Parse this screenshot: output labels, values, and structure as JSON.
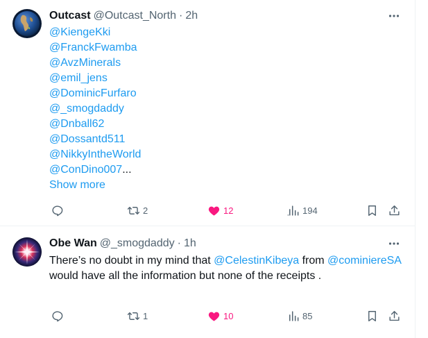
{
  "tweets": [
    {
      "author": {
        "name": "Outcast",
        "handle": "@Outcast_North",
        "avatar_icon": "globe-avatar-icon"
      },
      "time": "2h",
      "mentions": [
        "@KiengeKki",
        "@FranckFwamba",
        "@AvzMinerals",
        "@emil_jens",
        "@DominicFurfaro",
        "@_smogdaddy",
        "@Dnball62",
        "@Dossantd511",
        "@NikkyIntheWorld",
        "@ConDino007"
      ],
      "ellipsis": "...",
      "show_more": "Show more",
      "metrics": {
        "replies": "",
        "retweets": "2",
        "likes": "12",
        "views": "194"
      }
    },
    {
      "author": {
        "name": "Obe Wan",
        "handle": "@_smogdaddy",
        "avatar_icon": "starburst-avatar-icon"
      },
      "time": "1h",
      "text": {
        "p1": "There’s no doubt in my mind that ",
        "m1": "@CelestinKibeya",
        "p2": " from ",
        "m2": "@cominiereSA",
        "p3": " would have all the information but none of the receipts ."
      },
      "metrics": {
        "replies": "",
        "retweets": "1",
        "likes": "10",
        "views": "85"
      }
    }
  ],
  "ui": {
    "dot": "·"
  },
  "colors": {
    "accent": "#1d9bf0",
    "like": "#f91880",
    "muted": "#536471",
    "text": "#0f1419",
    "border": "#eff3f4"
  }
}
